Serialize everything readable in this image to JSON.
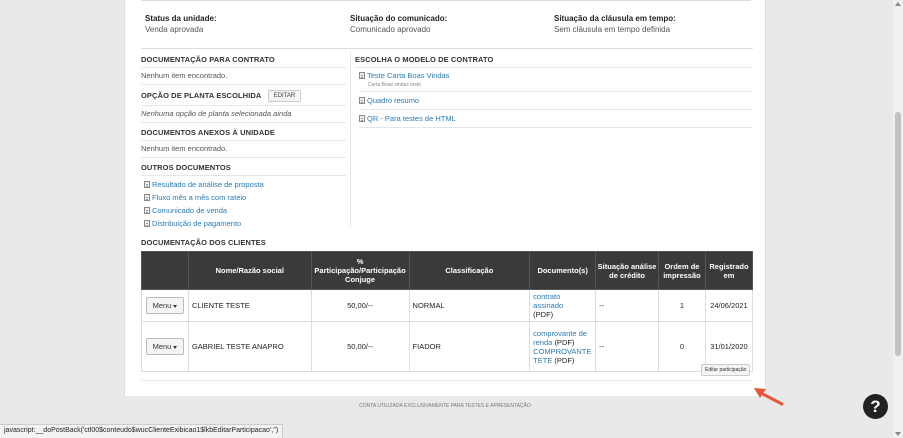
{
  "status": {
    "unidade_label": "Status da unidade:",
    "unidade_value": "Venda aprovada",
    "comunicado_label": "Situação do comunicado:",
    "comunicado_value": "Comunicado aprovado",
    "clausula_label": "Situação da cláusula em tempo:",
    "clausula_value": "Sem cláusula em tempo definida"
  },
  "left": {
    "doc_contrato_title": "DOCUMENTAÇÃO PARA CONTRATO",
    "doc_contrato_empty": "Nenhum item encontrado.",
    "planta_title": "OPÇÃO DE PLANTA ESCOLHIDA",
    "planta_edit": "EDITAR",
    "planta_empty": "Nenhuma opção de planta selecionada ainda",
    "anexos_title": "DOCUMENTOS ANEXOS À UNIDADE",
    "anexos_empty": "Nenhum item encontrado.",
    "outros_title": "OUTROS DOCUMENTOS",
    "outros_items": [
      "Resultado de análise de proposta",
      "Fluxo mês a mês com rateio",
      "Comunicado de venda",
      "Distribuição de pagamento"
    ]
  },
  "right": {
    "modelo_title": "ESCOLHA O MODELO DE CONTRATO",
    "modelos": [
      {
        "label": "Teste Carta Boas Vindas",
        "note": "Carta Boas vindas teste"
      },
      {
        "label": "Quadro resumo",
        "note": ""
      },
      {
        "label": "QR - Para testes de HTML",
        "note": ""
      }
    ]
  },
  "clientes": {
    "title": "DOCUMENTAÇÃO DOS CLIENTES",
    "headers": [
      "",
      "Nome/Razão social",
      "% Participação/Participação Conjuge",
      "Classificação",
      "Documento(s)",
      "Situação análise de crédito",
      "Ordem de impressão",
      "Registrado em"
    ],
    "rows": [
      {
        "menu": "Menu",
        "nome": "CLIENTE TESTE",
        "participacao": "50,00/--",
        "classificacao": "NORMAL",
        "doc1": "contrato assinado",
        "doc1_ext": "(PDF)",
        "doc2": "",
        "doc2_ext": "",
        "situacao": "--",
        "ordem": "1",
        "registrado": "24/06/2021"
      },
      {
        "menu": "Menu",
        "nome": "GABRIEL TESTE ANAPRO",
        "participacao": "50,00/--",
        "classificacao": "FIADOR",
        "doc1": "comprovante de renda",
        "doc1_ext": "(PDF)",
        "doc2": "COMPROVANTE TETE",
        "doc2_ext": "(PDF)",
        "situacao": "--",
        "ordem": "0",
        "registrado": "31/01/2020"
      }
    ],
    "editar_participacao": "Editar participação"
  },
  "footer": "CONTA UTILIZADA EXCLUSIVAMENTE PARA TESTES E APRESENTAÇÃO",
  "help": "?",
  "statusbar": "javascript:__doPostBack('ctl00$conteudo$wucClienteExibicao1$lkbEditarParticipacao','')",
  "colors": {
    "link": "#2a7ab8",
    "header_bg": "#3a3a3a",
    "arrow": "#e8553a"
  }
}
